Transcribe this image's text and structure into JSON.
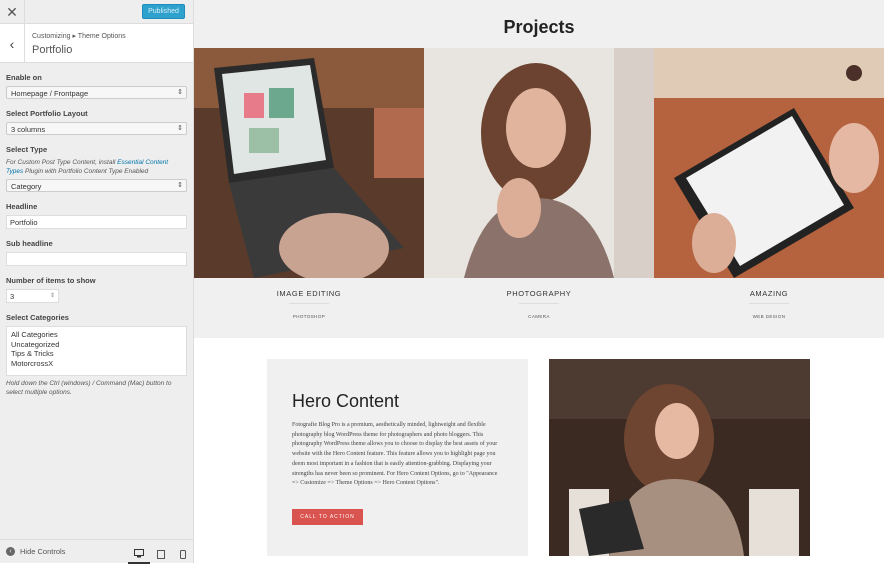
{
  "topbar": {
    "close_icon": "close-icon",
    "publish_label": "Published"
  },
  "header": {
    "breadcrumb": "Customizing ▸ Theme Options",
    "title": "Portfolio"
  },
  "controls": {
    "enable_on": {
      "label": "Enable on",
      "value": "Homepage / Frontpage"
    },
    "layout": {
      "label": "Select Portfolio Layout",
      "value": "3 columns"
    },
    "type": {
      "label": "Select Type",
      "desc_pre": "For Custom Post Type Content, install ",
      "desc_link": "Essential Content Types",
      "desc_post": " Plugin with Portfolio Content Type Enabled",
      "value": "Category"
    },
    "headline": {
      "label": "Headline",
      "value": "Portfolio"
    },
    "subheadline": {
      "label": "Sub headline",
      "value": ""
    },
    "items": {
      "label": "Number of items to show",
      "value": "3"
    },
    "categories": {
      "label": "Select Categories",
      "options": [
        "All Categories",
        "Uncategorized",
        "Tips & Tricks",
        "MotorcrossX"
      ],
      "help": "Hold down the Ctrl (windows) / Command (Mac) button to select multiple options."
    }
  },
  "bottom": {
    "hide_label": "Hide Controls",
    "devices": [
      "desktop-icon",
      "tablet-icon",
      "mobile-icon"
    ]
  },
  "projects": {
    "title": "Projects",
    "items": [
      {
        "title": "IMAGE EDITING",
        "sub": "PHOTOSHOP"
      },
      {
        "title": "PHOTOGRAPHY",
        "sub": "CAMERA"
      },
      {
        "title": "AMAZING",
        "sub": "WEB DESIGN"
      }
    ]
  },
  "hero": {
    "title": "Hero Content",
    "text": "Fotografie Blog Pro is a premium, aesthetically minded, lightweight and flexible photography blog WordPress theme for photographers and photo bloggers. This photography WordPress theme allows you to choose to display the best assets of your website with the Hero Content feature. This feature allows you to highlight page you deem most important in a fashion that is easily attention-grabbing. Displaying your strengths has never been so prominent. For Hero Content Options, go to \"Appearance => Customize => Theme Options => Hero Content Options\".",
    "cta": "CALL TO ACTION"
  },
  "colors": {
    "accent": "#2ea2cc",
    "cta": "#d9534f",
    "panel_bg": "#eeeeee"
  }
}
